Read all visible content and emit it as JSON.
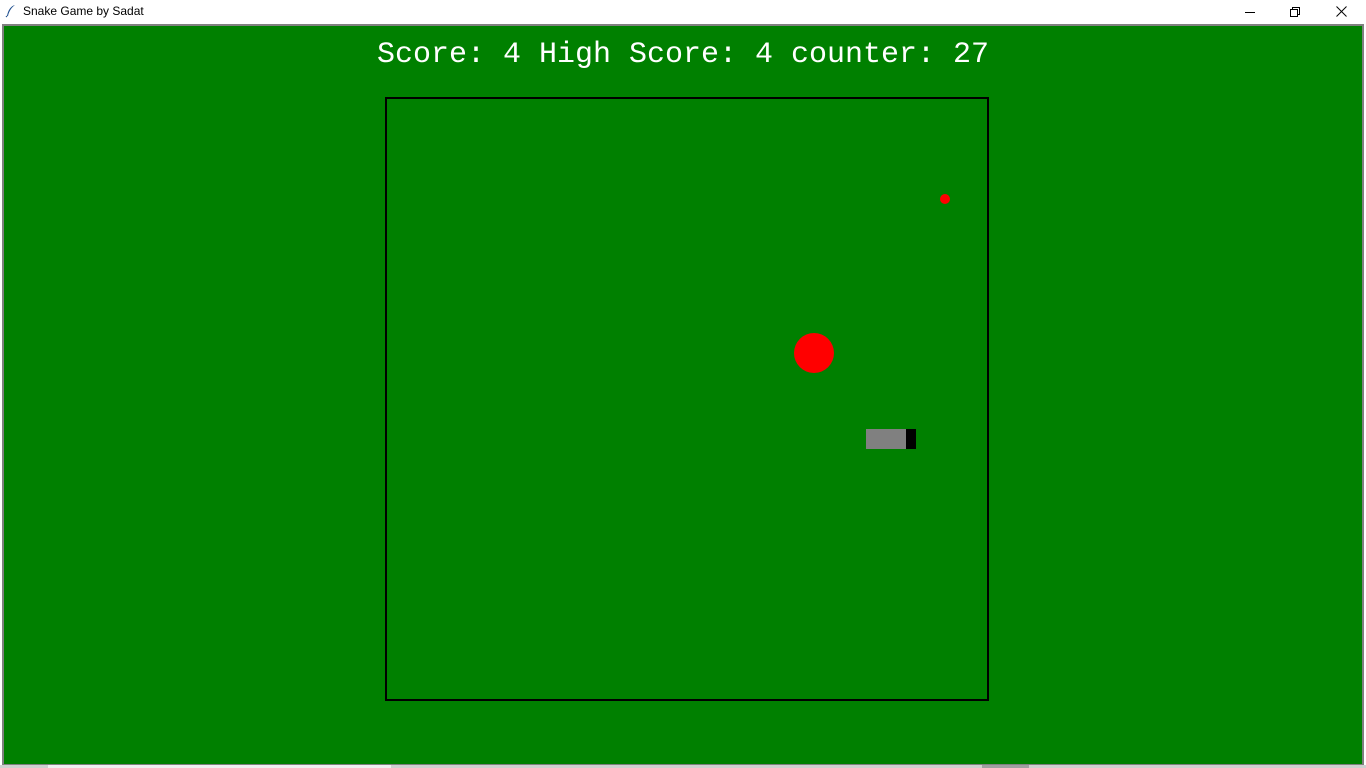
{
  "window": {
    "title": "Snake Game by Sadat",
    "icons": {
      "app": "feather-icon",
      "minimize": "minimize-icon",
      "maximize": "restore-icon",
      "close": "close-icon"
    }
  },
  "game": {
    "score_line": "Score: 4 High Score: 4 counter: 27",
    "score": 4,
    "high_score": 4,
    "counter": 27,
    "colors": {
      "background": "#008000",
      "text": "#ffffff",
      "border": "#000000",
      "food": "#ff0000",
      "snake_body": "#808080",
      "snake_head": "#000000"
    }
  }
}
